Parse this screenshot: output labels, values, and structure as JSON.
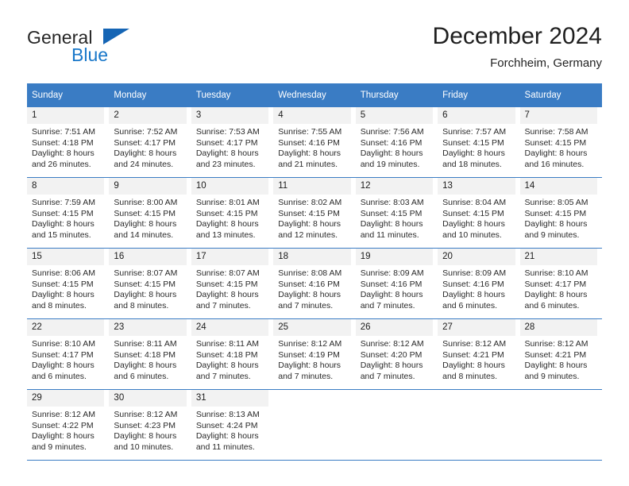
{
  "logo": {
    "word1": "General",
    "word2": "Blue",
    "triangle_color": "#1565b5",
    "blue_color": "#1877c9"
  },
  "header": {
    "title": "December 2024",
    "location": "Forchheim, Germany"
  },
  "calendar": {
    "header_bg": "#3a7cc4",
    "header_text_color": "#ffffff",
    "daynum_bg": "#f2f2f2",
    "weekdays": [
      "Sunday",
      "Monday",
      "Tuesday",
      "Wednesday",
      "Thursday",
      "Friday",
      "Saturday"
    ],
    "labels": {
      "sunrise": "Sunrise:",
      "sunset": "Sunset:",
      "daylight": "Daylight:"
    },
    "weeks": [
      [
        {
          "day": "1",
          "sunrise": "Sunrise: 7:51 AM",
          "sunset": "Sunset: 4:18 PM",
          "daylight_1": "Daylight: 8 hours",
          "daylight_2": "and 26 minutes."
        },
        {
          "day": "2",
          "sunrise": "Sunrise: 7:52 AM",
          "sunset": "Sunset: 4:17 PM",
          "daylight_1": "Daylight: 8 hours",
          "daylight_2": "and 24 minutes."
        },
        {
          "day": "3",
          "sunrise": "Sunrise: 7:53 AM",
          "sunset": "Sunset: 4:17 PM",
          "daylight_1": "Daylight: 8 hours",
          "daylight_2": "and 23 minutes."
        },
        {
          "day": "4",
          "sunrise": "Sunrise: 7:55 AM",
          "sunset": "Sunset: 4:16 PM",
          "daylight_1": "Daylight: 8 hours",
          "daylight_2": "and 21 minutes."
        },
        {
          "day": "5",
          "sunrise": "Sunrise: 7:56 AM",
          "sunset": "Sunset: 4:16 PM",
          "daylight_1": "Daylight: 8 hours",
          "daylight_2": "and 19 minutes."
        },
        {
          "day": "6",
          "sunrise": "Sunrise: 7:57 AM",
          "sunset": "Sunset: 4:15 PM",
          "daylight_1": "Daylight: 8 hours",
          "daylight_2": "and 18 minutes."
        },
        {
          "day": "7",
          "sunrise": "Sunrise: 7:58 AM",
          "sunset": "Sunset: 4:15 PM",
          "daylight_1": "Daylight: 8 hours",
          "daylight_2": "and 16 minutes."
        }
      ],
      [
        {
          "day": "8",
          "sunrise": "Sunrise: 7:59 AM",
          "sunset": "Sunset: 4:15 PM",
          "daylight_1": "Daylight: 8 hours",
          "daylight_2": "and 15 minutes."
        },
        {
          "day": "9",
          "sunrise": "Sunrise: 8:00 AM",
          "sunset": "Sunset: 4:15 PM",
          "daylight_1": "Daylight: 8 hours",
          "daylight_2": "and 14 minutes."
        },
        {
          "day": "10",
          "sunrise": "Sunrise: 8:01 AM",
          "sunset": "Sunset: 4:15 PM",
          "daylight_1": "Daylight: 8 hours",
          "daylight_2": "and 13 minutes."
        },
        {
          "day": "11",
          "sunrise": "Sunrise: 8:02 AM",
          "sunset": "Sunset: 4:15 PM",
          "daylight_1": "Daylight: 8 hours",
          "daylight_2": "and 12 minutes."
        },
        {
          "day": "12",
          "sunrise": "Sunrise: 8:03 AM",
          "sunset": "Sunset: 4:15 PM",
          "daylight_1": "Daylight: 8 hours",
          "daylight_2": "and 11 minutes."
        },
        {
          "day": "13",
          "sunrise": "Sunrise: 8:04 AM",
          "sunset": "Sunset: 4:15 PM",
          "daylight_1": "Daylight: 8 hours",
          "daylight_2": "and 10 minutes."
        },
        {
          "day": "14",
          "sunrise": "Sunrise: 8:05 AM",
          "sunset": "Sunset: 4:15 PM",
          "daylight_1": "Daylight: 8 hours",
          "daylight_2": "and 9 minutes."
        }
      ],
      [
        {
          "day": "15",
          "sunrise": "Sunrise: 8:06 AM",
          "sunset": "Sunset: 4:15 PM",
          "daylight_1": "Daylight: 8 hours",
          "daylight_2": "and 8 minutes."
        },
        {
          "day": "16",
          "sunrise": "Sunrise: 8:07 AM",
          "sunset": "Sunset: 4:15 PM",
          "daylight_1": "Daylight: 8 hours",
          "daylight_2": "and 8 minutes."
        },
        {
          "day": "17",
          "sunrise": "Sunrise: 8:07 AM",
          "sunset": "Sunset: 4:15 PM",
          "daylight_1": "Daylight: 8 hours",
          "daylight_2": "and 7 minutes."
        },
        {
          "day": "18",
          "sunrise": "Sunrise: 8:08 AM",
          "sunset": "Sunset: 4:16 PM",
          "daylight_1": "Daylight: 8 hours",
          "daylight_2": "and 7 minutes."
        },
        {
          "day": "19",
          "sunrise": "Sunrise: 8:09 AM",
          "sunset": "Sunset: 4:16 PM",
          "daylight_1": "Daylight: 8 hours",
          "daylight_2": "and 7 minutes."
        },
        {
          "day": "20",
          "sunrise": "Sunrise: 8:09 AM",
          "sunset": "Sunset: 4:16 PM",
          "daylight_1": "Daylight: 8 hours",
          "daylight_2": "and 6 minutes."
        },
        {
          "day": "21",
          "sunrise": "Sunrise: 8:10 AM",
          "sunset": "Sunset: 4:17 PM",
          "daylight_1": "Daylight: 8 hours",
          "daylight_2": "and 6 minutes."
        }
      ],
      [
        {
          "day": "22",
          "sunrise": "Sunrise: 8:10 AM",
          "sunset": "Sunset: 4:17 PM",
          "daylight_1": "Daylight: 8 hours",
          "daylight_2": "and 6 minutes."
        },
        {
          "day": "23",
          "sunrise": "Sunrise: 8:11 AM",
          "sunset": "Sunset: 4:18 PM",
          "daylight_1": "Daylight: 8 hours",
          "daylight_2": "and 6 minutes."
        },
        {
          "day": "24",
          "sunrise": "Sunrise: 8:11 AM",
          "sunset": "Sunset: 4:18 PM",
          "daylight_1": "Daylight: 8 hours",
          "daylight_2": "and 7 minutes."
        },
        {
          "day": "25",
          "sunrise": "Sunrise: 8:12 AM",
          "sunset": "Sunset: 4:19 PM",
          "daylight_1": "Daylight: 8 hours",
          "daylight_2": "and 7 minutes."
        },
        {
          "day": "26",
          "sunrise": "Sunrise: 8:12 AM",
          "sunset": "Sunset: 4:20 PM",
          "daylight_1": "Daylight: 8 hours",
          "daylight_2": "and 7 minutes."
        },
        {
          "day": "27",
          "sunrise": "Sunrise: 8:12 AM",
          "sunset": "Sunset: 4:21 PM",
          "daylight_1": "Daylight: 8 hours",
          "daylight_2": "and 8 minutes."
        },
        {
          "day": "28",
          "sunrise": "Sunrise: 8:12 AM",
          "sunset": "Sunset: 4:21 PM",
          "daylight_1": "Daylight: 8 hours",
          "daylight_2": "and 9 minutes."
        }
      ],
      [
        {
          "day": "29",
          "sunrise": "Sunrise: 8:12 AM",
          "sunset": "Sunset: 4:22 PM",
          "daylight_1": "Daylight: 8 hours",
          "daylight_2": "and 9 minutes."
        },
        {
          "day": "30",
          "sunrise": "Sunrise: 8:12 AM",
          "sunset": "Sunset: 4:23 PM",
          "daylight_1": "Daylight: 8 hours",
          "daylight_2": "and 10 minutes."
        },
        {
          "day": "31",
          "sunrise": "Sunrise: 8:13 AM",
          "sunset": "Sunset: 4:24 PM",
          "daylight_1": "Daylight: 8 hours",
          "daylight_2": "and 11 minutes."
        },
        {
          "day": "",
          "sunrise": "",
          "sunset": "",
          "daylight_1": "",
          "daylight_2": ""
        },
        {
          "day": "",
          "sunrise": "",
          "sunset": "",
          "daylight_1": "",
          "daylight_2": ""
        },
        {
          "day": "",
          "sunrise": "",
          "sunset": "",
          "daylight_1": "",
          "daylight_2": ""
        },
        {
          "day": "",
          "sunrise": "",
          "sunset": "",
          "daylight_1": "",
          "daylight_2": ""
        }
      ]
    ]
  }
}
